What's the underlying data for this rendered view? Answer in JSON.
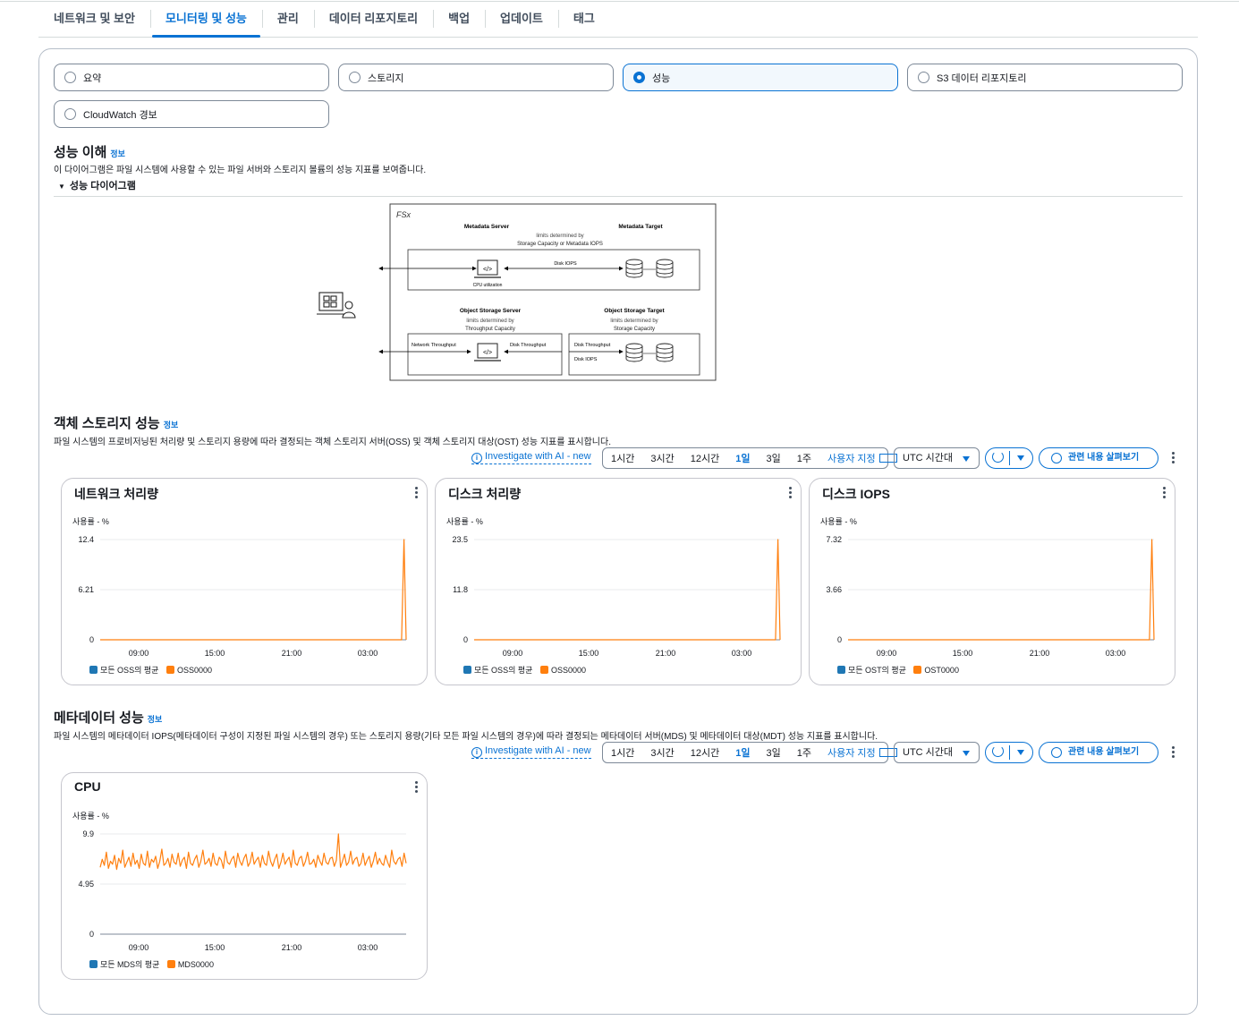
{
  "tabs": [
    "네트워크 및 보안",
    "모니터링 및 성능",
    "관리",
    "데이터 리포지토리",
    "백업",
    "업데이트",
    "태그"
  ],
  "active_tab": "모니터링 및 성능",
  "view_options": {
    "summary": "요약",
    "storage": "스토리지",
    "performance": "성능",
    "s3": "S3 데이터 리포지토리",
    "cloudwatch": "CloudWatch 경보",
    "selected": "성능"
  },
  "understand": {
    "title": "성능 이해",
    "info": "정보",
    "desc": "이 다이어그램은 파일 시스템에 사용할 수 있는 파일 서버와 스토리지 볼륨의 성능 지표를 보여줍니다.",
    "expander": "성능 다이어그램"
  },
  "diagram": {
    "logo": "FSx",
    "metadata_server": "Metadata Server",
    "metadata_target": "Metadata Target",
    "md_limits_1": "limits determined by",
    "md_limits_2": "Storage Capacity or Metadata IOPS",
    "disk_iops": "Disk IOPS",
    "cpu": "CPU utilization",
    "oss": "Object Storage Server",
    "ost": "Object Storage Target",
    "oss_limits_1": "limits determined by",
    "oss_limits_2": "Throughput Capacity",
    "ost_limits_1": "limits determined by",
    "ost_limits_2": "Storage Capacity",
    "network_throughput": "Network Throughput",
    "disk_throughput": "Disk Throughput",
    "disk_throughput_2": "Disk Throughput",
    "disk_iops_2": "Disk IOPS"
  },
  "object_storage": {
    "title": "객체 스토리지 성능",
    "info": "정보",
    "desc": "파일 시스템의 프로비저닝된 처리량 및 스토리지 용량에 따라 결정되는 객체 스토리지 서버(OSS) 및 객체 스토리지 대상(OST) 성능 지표를 표시합니다."
  },
  "metadata": {
    "title": "메타데이터 성능",
    "info": "정보",
    "desc": "파일 시스템의 메타데이터 IOPS(메타데이터 구성이 지정된 파일 시스템의 경우) 또는 스토리지 용량(기타 모든 파일 시스템의 경우)에 따라 결정되는 메타데이터 서버(MDS) 및 메타데이터 대상(MDT) 성능 지표를 표시합니다."
  },
  "toolbar": {
    "ai_link": "Investigate with AI - new",
    "ranges": [
      "1시간",
      "3시간",
      "12시간",
      "1일",
      "3일",
      "1주"
    ],
    "selected_range": "1일",
    "custom": "사용자 지정",
    "timezone": "UTC 시간대",
    "explore": "관련 내용 살펴보기"
  },
  "colors": {
    "avg": "#1f77b4",
    "series": "#ff7f0e",
    "accent": "#0972d3"
  },
  "chart_data": [
    {
      "type": "line",
      "title": "네트워크 처리량",
      "ylabel": "사용률 - %",
      "y_ticks": [
        "12.4",
        "6.21",
        "0"
      ],
      "x_ticks": [
        "09:00",
        "15:00",
        "21:00",
        "03:00"
      ],
      "ylim": [
        0,
        12.4
      ],
      "series": [
        {
          "name": "모든 OSS의 평균",
          "color": "#1f77b4",
          "values": []
        },
        {
          "name": "OSS0000",
          "color": "#ff7f0e",
          "x": [
            0,
            0.96,
            0.985,
            0.993,
            1.0
          ],
          "values": [
            0.0,
            0.0,
            0.0,
            12.4,
            0.0
          ]
        }
      ]
    },
    {
      "type": "line",
      "title": "디스크 처리량",
      "ylabel": "사용률 - %",
      "y_ticks": [
        "23.5",
        "11.8",
        "0"
      ],
      "x_ticks": [
        "09:00",
        "15:00",
        "21:00",
        "03:00"
      ],
      "ylim": [
        0,
        23.5
      ],
      "series": [
        {
          "name": "모든 OSS의 평균",
          "color": "#1f77b4",
          "values": []
        },
        {
          "name": "OSS0000",
          "color": "#ff7f0e",
          "x": [
            0,
            0.96,
            0.985,
            0.993,
            1.0
          ],
          "values": [
            0.0,
            0.0,
            0.0,
            23.5,
            0.0
          ]
        }
      ]
    },
    {
      "type": "line",
      "title": "디스크 IOPS",
      "ylabel": "사용률 - %",
      "y_ticks": [
        "7.32",
        "3.66",
        "0"
      ],
      "x_ticks": [
        "09:00",
        "15:00",
        "21:00",
        "03:00"
      ],
      "ylim": [
        0,
        7.32
      ],
      "series": [
        {
          "name": "모든 OST의 평균",
          "color": "#1f77b4",
          "values": []
        },
        {
          "name": "OST0000",
          "color": "#ff7f0e",
          "x": [
            0,
            0.96,
            0.985,
            0.993,
            1.0
          ],
          "values": [
            0.0,
            0.0,
            0.0,
            7.32,
            0.0
          ]
        }
      ]
    },
    {
      "type": "line",
      "title": "CPU",
      "ylabel": "사용률 - %",
      "y_ticks": [
        "9.9",
        "4.95",
        "0"
      ],
      "x_ticks": [
        "09:00",
        "15:00",
        "21:00",
        "03:00"
      ],
      "ylim": [
        0,
        9.9
      ],
      "series": [
        {
          "name": "모든 MDS의 평균",
          "color": "#1f77b4",
          "values": []
        },
        {
          "name": "MDS0000",
          "color": "#ff7f0e",
          "values": [
            6.6,
            7.4,
            6.8,
            8.1,
            6.5,
            7.2,
            6.9,
            7.8,
            6.4,
            7.5,
            7.0,
            8.3,
            6.6,
            7.1,
            7.6,
            6.7,
            8.0,
            6.9,
            7.3,
            6.5,
            7.9,
            7.0,
            6.8,
            8.2,
            6.6,
            7.4,
            7.1,
            7.7,
            6.5,
            7.2,
            8.4,
            6.8,
            7.0,
            7.5,
            6.6,
            7.9,
            7.1,
            6.9,
            8.0,
            6.7,
            7.3,
            7.6,
            6.5,
            8.1,
            7.0,
            6.8,
            7.4,
            7.8,
            6.6,
            7.2,
            8.3,
            6.9,
            7.1,
            7.5,
            6.7,
            8.0,
            7.0,
            6.8,
            7.6,
            7.3,
            6.5,
            8.2,
            7.1,
            6.9,
            7.4,
            7.7,
            6.6,
            8.0,
            7.2,
            6.8,
            7.5,
            7.9,
            6.7,
            7.1,
            8.1,
            6.9,
            7.3,
            7.6,
            6.6,
            7.8,
            7.0,
            6.8,
            8.2,
            7.2,
            6.7,
            7.4,
            7.9,
            6.5,
            7.1,
            8.0,
            6.9,
            7.3,
            7.6,
            6.6,
            8.3,
            7.0,
            6.8,
            7.5,
            7.7,
            6.7,
            7.2,
            8.1,
            6.9,
            7.0,
            7.4,
            6.6,
            7.8,
            7.2,
            6.8,
            8.0,
            7.1,
            6.9,
            7.5,
            7.6,
            6.7,
            7.3,
            9.9,
            6.6,
            7.2,
            7.9,
            6.8,
            7.1,
            8.2,
            6.9,
            7.4,
            7.6,
            6.7,
            7.0,
            8.0,
            6.8,
            7.3,
            7.7,
            6.6,
            7.2,
            8.1,
            6.9,
            7.5,
            7.0,
            6.8,
            7.8,
            7.1,
            6.6,
            8.3,
            7.2,
            6.9,
            7.4,
            7.6,
            6.7,
            8.0,
            7.0
          ]
        }
      ]
    }
  ]
}
